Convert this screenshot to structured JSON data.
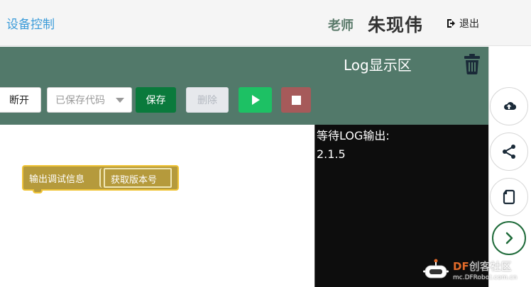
{
  "header": {
    "device_control": "设备控制",
    "teacher_label": "老师",
    "teacher_name": "朱现伟",
    "logout_label": "退出"
  },
  "toolbar": {
    "log_title": "Log显示区",
    "disconnect_label": "断开",
    "saved_code_placeholder": "已保存代码",
    "save_label": "保存",
    "delete_label": "删除"
  },
  "workspace": {
    "block_label": "输出调试信息",
    "inner_block_label": "获取版本号"
  },
  "log": {
    "lines": [
      "等待LOG输出:",
      "",
      "2.1.5"
    ]
  },
  "watermark": {
    "brand_prefix": "DF",
    "brand_rest": "创客社区",
    "url": "mc.DFRobot.com.cn"
  },
  "colors": {
    "toolbar_bg": "#52796a",
    "save_green": "#0a7a3c",
    "run_green": "#1dc164",
    "stop_red": "#a65a5a",
    "block_fill": "#b59a3c",
    "block_border": "#f0c437",
    "link_blue": "#3a9bd9"
  },
  "icons": {
    "logout": "logout-icon",
    "trash": "trash-icon",
    "run": "play-icon",
    "stop": "stop-icon",
    "upload": "cloud-upload-icon",
    "share": "share-icon",
    "file": "file-icon",
    "next": "chevron-right-icon"
  }
}
